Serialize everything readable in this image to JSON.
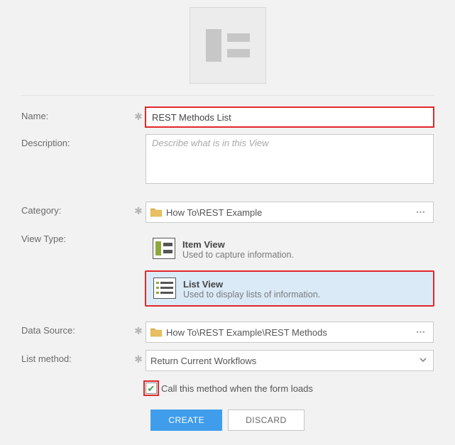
{
  "form": {
    "name_label": "Name:",
    "name_value": "REST Methods List",
    "desc_label": "Description:",
    "desc_placeholder": "Describe what is in this View",
    "category_label": "Category:",
    "category_value": "How To\\REST Example",
    "viewtype_label": "View Type:",
    "viewtypes": [
      {
        "title": "Item View",
        "sub": "Used to capture information."
      },
      {
        "title": "List View",
        "sub": "Used to display lists of information."
      }
    ],
    "datasource_label": "Data Source:",
    "datasource_value": "How To\\REST Example\\REST Methods",
    "listmethod_label": "List method:",
    "listmethod_value": "Return Current Workflows",
    "autoload_label": "Call this method when the form loads"
  },
  "buttons": {
    "create": "CREATE",
    "discard": "DISCARD"
  }
}
